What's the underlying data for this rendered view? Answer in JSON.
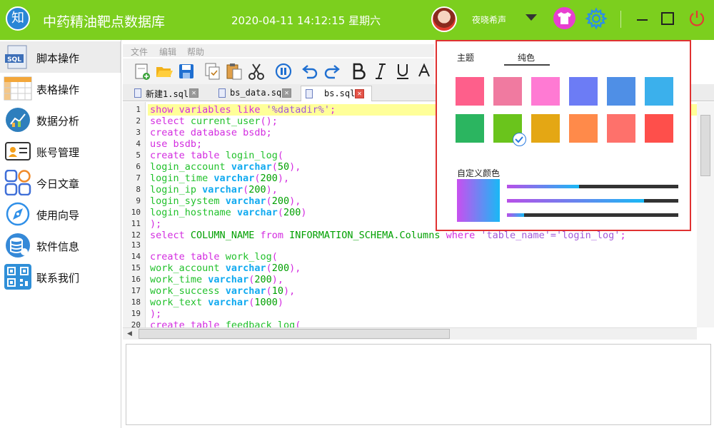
{
  "titlebar": {
    "logo_char": "知",
    "app_title": "中药精油靶点数据库",
    "datetime": "2020-04-11 14:12:15 星期六",
    "username": "夜晓希声"
  },
  "sidebar": {
    "items": [
      {
        "label": "脚本操作",
        "icon": "sql-file-icon"
      },
      {
        "label": "表格操作",
        "icon": "table-icon"
      },
      {
        "label": "数据分析",
        "icon": "chart-icon"
      },
      {
        "label": "账号管理",
        "icon": "id-card-icon"
      },
      {
        "label": "今日文章",
        "icon": "grid-icon"
      },
      {
        "label": "使用向导",
        "icon": "compass-icon"
      },
      {
        "label": "软件信息",
        "icon": "database-icon"
      },
      {
        "label": "联系我们",
        "icon": "qr-code-icon"
      }
    ]
  },
  "menubar": {
    "items": [
      "文件",
      "编辑",
      "帮助"
    ]
  },
  "tabs": [
    {
      "label": "新建1.sql"
    },
    {
      "label": "bs_data.sql"
    },
    {
      "label": "bs.sql"
    }
  ],
  "editor": {
    "line_numbers": [
      "1",
      "2",
      "3",
      "4",
      "5",
      "6",
      "7",
      "8",
      "9",
      "10",
      "11",
      "12",
      "13",
      "14",
      "15",
      "16",
      "17",
      "18",
      "19",
      "20"
    ]
  },
  "theme_popup": {
    "tab_theme": "主题",
    "tab_solid": "纯色",
    "custom_color_label": "自定义颜色",
    "swatches": [
      "#fe5f8b",
      "#f07aa0",
      "#ff7ad3",
      "#6c7cf5",
      "#4f8fe6",
      "#3bb0ec",
      "#2bb560",
      "#6ac41c",
      "#e4a714",
      "#ff8a4a",
      "#fe716b",
      "#fe4f4b"
    ],
    "selected_swatch": 7,
    "sliders": [
      0.42,
      0.8,
      0.1
    ]
  },
  "colors": {
    "titlebar": "#7ccf1e",
    "popup_border": "#e03131"
  }
}
